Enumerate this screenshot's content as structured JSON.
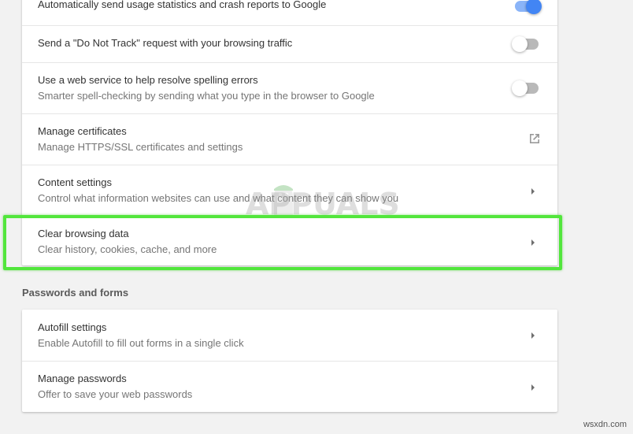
{
  "privacy": {
    "usage_stats": {
      "label": "Automatically send usage statistics and crash reports to Google",
      "enabled": true
    },
    "do_not_track": {
      "label": "Send a \"Do Not Track\" request with your browsing traffic",
      "enabled": false
    },
    "spelling": {
      "label": "Use a web service to help resolve spelling errors",
      "sub": "Smarter spell-checking by sending what you type in the browser to Google",
      "enabled": false
    },
    "certificates": {
      "label": "Manage certificates",
      "sub": "Manage HTTPS/SSL certificates and settings",
      "icon": "open-in-new-icon"
    },
    "content_settings": {
      "label": "Content settings",
      "sub": "Control what information websites can use and what content they can show you",
      "icon": "chevron-right-icon"
    },
    "clear_browsing": {
      "label": "Clear browsing data",
      "sub": "Clear history, cookies, cache, and more",
      "icon": "chevron-right-icon"
    }
  },
  "passwords_section": {
    "title": "Passwords and forms",
    "autofill": {
      "label": "Autofill settings",
      "sub": "Enable Autofill to fill out forms in a single click",
      "icon": "chevron-right-icon"
    },
    "manage_passwords": {
      "label": "Manage passwords",
      "sub": "Offer to save your web passwords",
      "icon": "chevron-right-icon"
    }
  },
  "overlay": {
    "watermark_text": "APPUALS",
    "site_mark": "wsxdn.com",
    "highlight_color": "#52e63c"
  },
  "colors": {
    "toggle_on": "#4285f4",
    "toggle_off": "#b9b9b9"
  }
}
